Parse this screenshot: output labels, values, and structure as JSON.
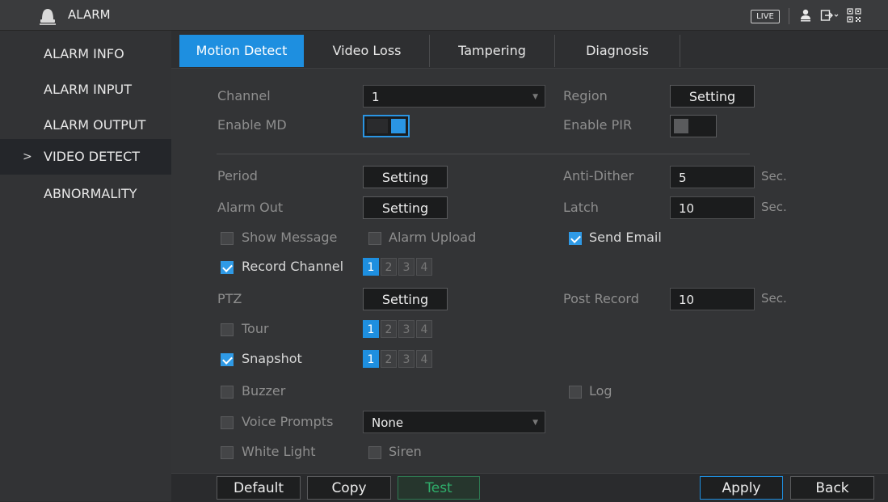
{
  "header": {
    "title": "ALARM",
    "live_label": "LIVE",
    "icons": [
      "alarm-bell-icon",
      "user-icon",
      "logout-icon",
      "qr-code-icon"
    ]
  },
  "sidebar": {
    "items": [
      {
        "label": "ALARM INFO",
        "active": false
      },
      {
        "label": "ALARM INPUT",
        "active": false
      },
      {
        "label": "ALARM OUTPUT",
        "active": false
      },
      {
        "label": "VIDEO DETECT",
        "active": true,
        "marker": ">"
      },
      {
        "label": "ABNORMALITY",
        "active": false
      }
    ]
  },
  "tabs": [
    {
      "label": "Motion Detect",
      "active": true
    },
    {
      "label": "Video Loss",
      "active": false
    },
    {
      "label": "Tampering",
      "active": false
    },
    {
      "label": "Diagnosis",
      "active": false
    }
  ],
  "form": {
    "channel": {
      "label": "Channel",
      "value": "1"
    },
    "region": {
      "label": "Region",
      "button": "Setting"
    },
    "enable_md": {
      "label": "Enable MD",
      "on": true
    },
    "enable_pir": {
      "label": "Enable PIR",
      "on": false
    },
    "period": {
      "label": "Period",
      "button": "Setting"
    },
    "anti_dither": {
      "label": "Anti-Dither",
      "value": "5",
      "unit": "Sec."
    },
    "alarm_out": {
      "label": "Alarm Out",
      "button": "Setting"
    },
    "latch": {
      "label": "Latch",
      "value": "10",
      "unit": "Sec."
    },
    "show_message": {
      "label": "Show Message",
      "checked": false
    },
    "alarm_upload": {
      "label": "Alarm Upload",
      "checked": false
    },
    "send_email": {
      "label": "Send Email",
      "checked": true
    },
    "record_channel": {
      "label": "Record Channel",
      "checked": true,
      "channels": [
        "1",
        "2",
        "3",
        "4"
      ],
      "selected": [
        "1"
      ]
    },
    "ptz": {
      "label": "PTZ",
      "button": "Setting"
    },
    "post_record": {
      "label": "Post Record",
      "value": "10",
      "unit": "Sec."
    },
    "tour": {
      "label": "Tour",
      "checked": false,
      "channels": [
        "1",
        "2",
        "3",
        "4"
      ],
      "selected": [
        "1"
      ]
    },
    "snapshot": {
      "label": "Snapshot",
      "checked": true,
      "channels": [
        "1",
        "2",
        "3",
        "4"
      ],
      "selected": [
        "1"
      ]
    },
    "buzzer": {
      "label": "Buzzer",
      "checked": false
    },
    "log": {
      "label": "Log",
      "checked": false
    },
    "voice_prompts": {
      "label": "Voice Prompts",
      "checked": false,
      "value": "None"
    },
    "white_light": {
      "label": "White Light",
      "checked": false
    },
    "siren": {
      "label": "Siren",
      "checked": false
    }
  },
  "footer": {
    "default_label": "Default",
    "copy_label": "Copy",
    "test_label": "Test",
    "apply_label": "Apply",
    "back_label": "Back"
  },
  "colors": {
    "accent": "#1e8fe0",
    "test_green": "#2fae6b",
    "background": "#2c2d2e"
  }
}
